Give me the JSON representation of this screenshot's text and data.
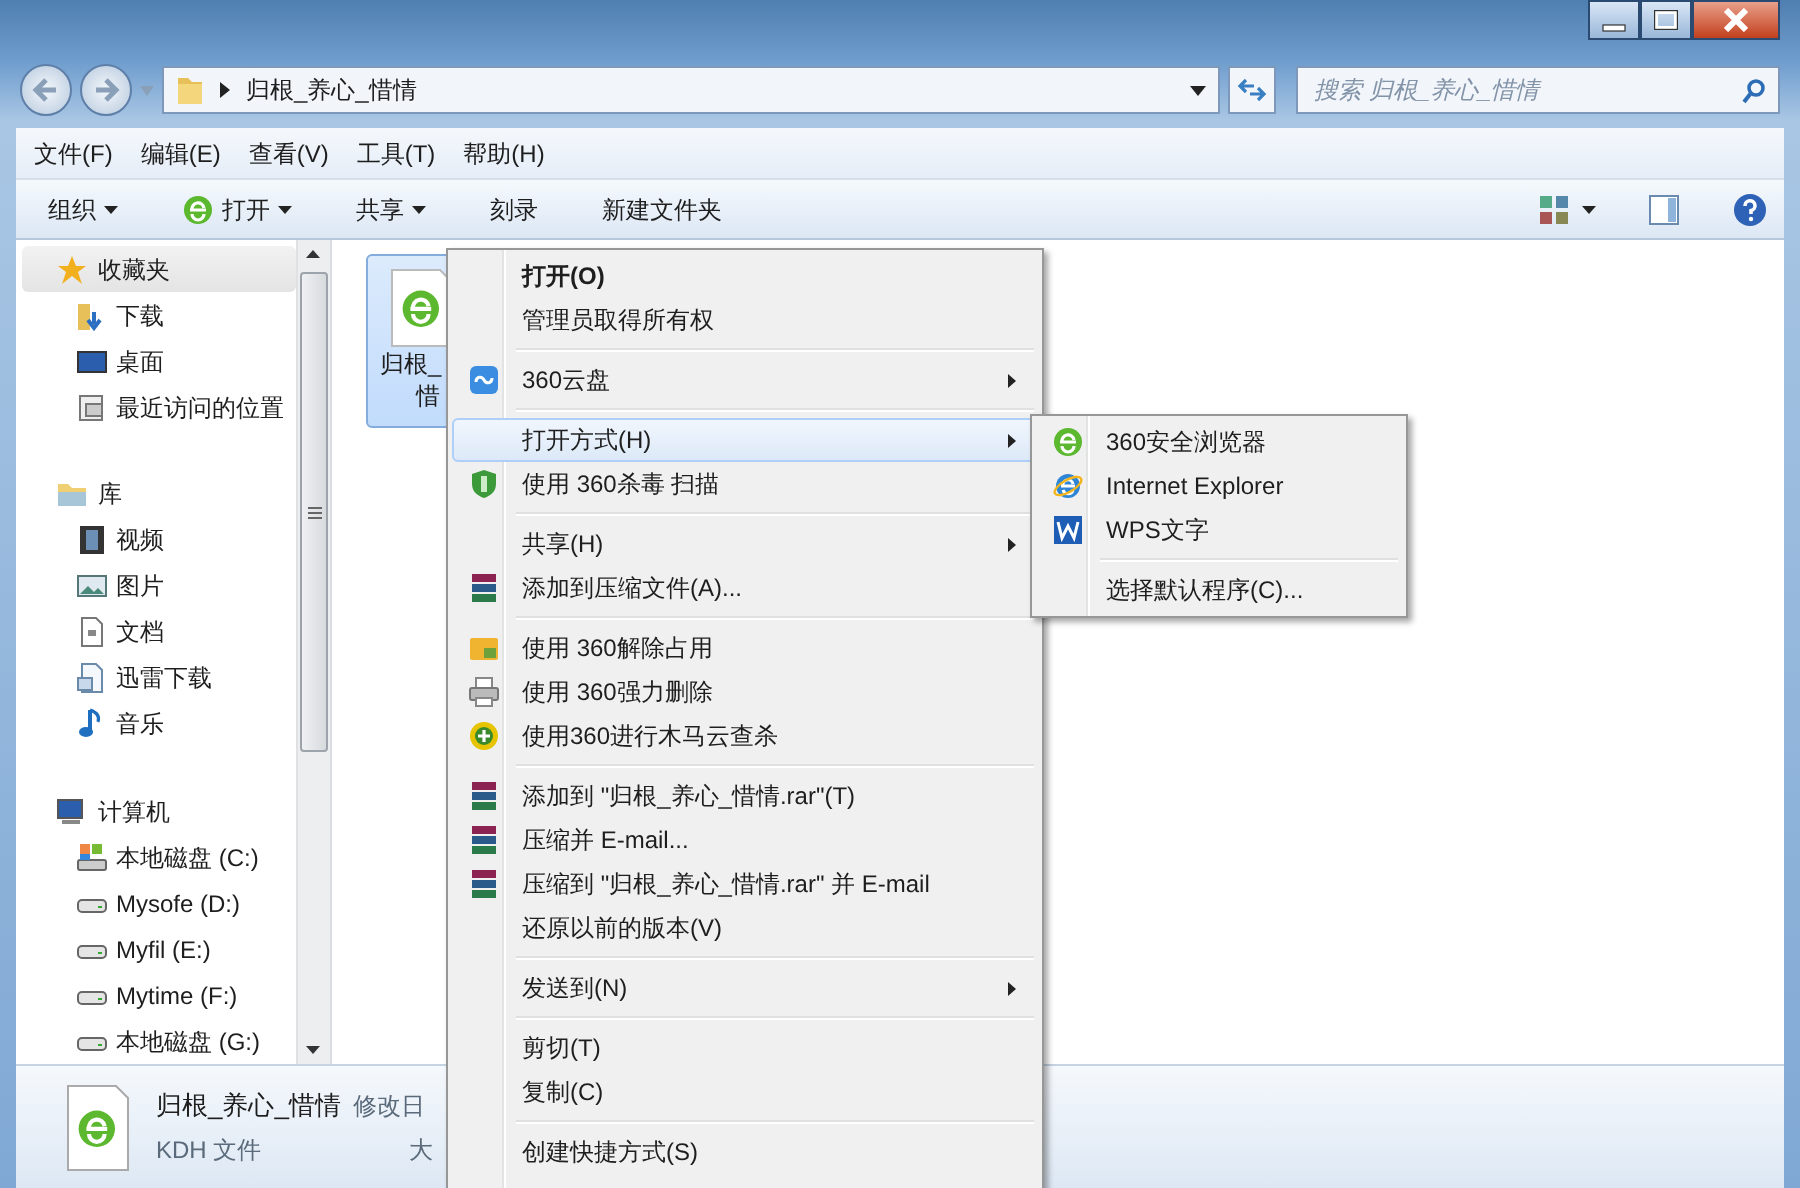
{
  "address": {
    "path": "归根_养心_惜情",
    "search_placeholder": "搜索 归根_养心_惜情"
  },
  "menubar": [
    "文件(F)",
    "编辑(E)",
    "查看(V)",
    "工具(T)",
    "帮助(H)"
  ],
  "toolbar": [
    {
      "label": "组织",
      "caret": true
    },
    {
      "label": "打开",
      "caret": true
    },
    {
      "label": "共享",
      "caret": true
    },
    {
      "label": "刻录",
      "caret": false
    },
    {
      "label": "新建文件夹",
      "caret": false
    }
  ],
  "sidebar": [
    {
      "label": "收藏夹",
      "selected": true,
      "children": [
        {
          "label": "下载",
          "selected": false
        },
        {
          "label": "桌面",
          "selected": false
        },
        {
          "label": "最近访问的位置",
          "selected": false
        }
      ]
    },
    {
      "label": "库",
      "selected": false,
      "children": [
        {
          "label": "视频",
          "selected": false
        },
        {
          "label": "图片",
          "selected": false
        },
        {
          "label": "文档",
          "selected": false
        },
        {
          "label": "迅雷下载",
          "selected": false
        },
        {
          "label": "音乐",
          "selected": false
        }
      ]
    },
    {
      "label": "计算机",
      "selected": false,
      "children": [
        {
          "label": "本地磁盘 (C:)",
          "selected": false
        },
        {
          "label": "Mysofe (D:)",
          "selected": false
        },
        {
          "label": "Myfil (E:)",
          "selected": false
        },
        {
          "label": "Mytime (F:)",
          "selected": false
        },
        {
          "label": "本地磁盘 (G:)",
          "selected": false
        }
      ]
    }
  ],
  "file": {
    "name_lines": [
      "归根_",
      "惜"
    ],
    "selected": true
  },
  "context_menu": [
    {
      "kind": "item",
      "label": "打开(O)",
      "bold": true,
      "submenu": false,
      "selected": false
    },
    {
      "kind": "item",
      "label": "管理员取得所有权",
      "bold": false,
      "submenu": false,
      "selected": false
    },
    {
      "kind": "separator"
    },
    {
      "kind": "item",
      "label": "360云盘",
      "bold": false,
      "submenu": true,
      "selected": false
    },
    {
      "kind": "separator"
    },
    {
      "kind": "item",
      "label": "打开方式(H)",
      "bold": false,
      "submenu": true,
      "selected": true
    },
    {
      "kind": "item",
      "label": "使用 360杀毒 扫描",
      "bold": false,
      "submenu": false,
      "selected": false
    },
    {
      "kind": "separator"
    },
    {
      "kind": "item",
      "label": "共享(H)",
      "bold": false,
      "submenu": true,
      "selected": false
    },
    {
      "kind": "item",
      "label": "添加到压缩文件(A)...",
      "bold": false,
      "submenu": false,
      "selected": false
    },
    {
      "kind": "separator"
    },
    {
      "kind": "item",
      "label": "使用 360解除占用",
      "bold": false,
      "submenu": false,
      "selected": false
    },
    {
      "kind": "item",
      "label": "使用 360强力删除",
      "bold": false,
      "submenu": false,
      "selected": false
    },
    {
      "kind": "item",
      "label": "使用360进行木马云查杀",
      "bold": false,
      "submenu": false,
      "selected": false
    },
    {
      "kind": "separator"
    },
    {
      "kind": "item",
      "label": "添加到 \"归根_养心_惜情.rar\"(T)",
      "bold": false,
      "submenu": false,
      "selected": false
    },
    {
      "kind": "item",
      "label": "压缩并 E-mail...",
      "bold": false,
      "submenu": false,
      "selected": false
    },
    {
      "kind": "item",
      "label": "压缩到 \"归根_养心_惜情.rar\" 并 E-mail",
      "bold": false,
      "submenu": false,
      "selected": false
    },
    {
      "kind": "item",
      "label": "还原以前的版本(V)",
      "bold": false,
      "submenu": false,
      "selected": false
    },
    {
      "kind": "separator"
    },
    {
      "kind": "item",
      "label": "发送到(N)",
      "bold": false,
      "submenu": true,
      "selected": false
    },
    {
      "kind": "separator"
    },
    {
      "kind": "item",
      "label": "剪切(T)",
      "bold": false,
      "submenu": false,
      "selected": false
    },
    {
      "kind": "item",
      "label": "复制(C)",
      "bold": false,
      "submenu": false,
      "selected": false
    },
    {
      "kind": "separator"
    },
    {
      "kind": "item",
      "label": "创建快捷方式(S)",
      "bold": false,
      "submenu": false,
      "selected": false
    }
  ],
  "open_with_menu": [
    {
      "kind": "item",
      "label": "360安全浏览器"
    },
    {
      "kind": "item",
      "label": "Internet Explorer"
    },
    {
      "kind": "item",
      "label": "WPS文字"
    },
    {
      "kind": "separator"
    },
    {
      "kind": "item",
      "label": "选择默认程序(C)..."
    }
  ],
  "details": {
    "name": "归根_养心_惜情",
    "type": "KDH 文件",
    "modified_label": "修改日",
    "size_label": "大"
  }
}
